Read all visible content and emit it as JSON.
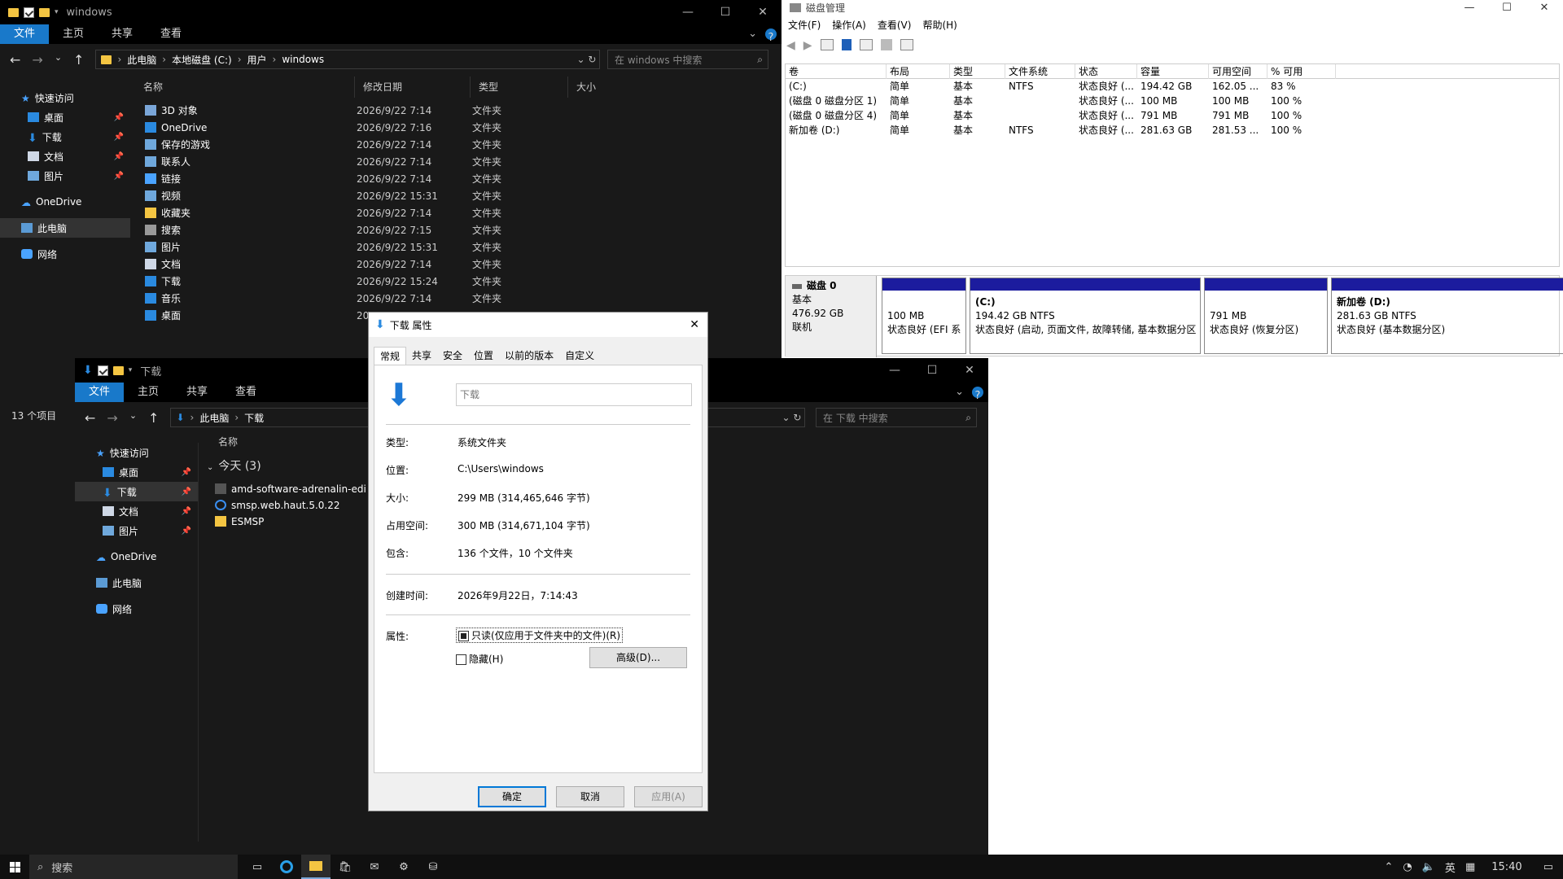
{
  "explorer_main": {
    "title": "windows",
    "ribbon_tabs": [
      "文件",
      "主页",
      "共享",
      "查看"
    ],
    "path": [
      "此电脑",
      "本地磁盘 (C:)",
      "用户",
      "windows"
    ],
    "search_placeholder": "在 windows 中搜索",
    "sidebar": [
      "快速访问",
      "桌面",
      "下载",
      "文档",
      "图片",
      "OneDrive",
      "此电脑",
      "网络"
    ],
    "columns": {
      "name": "名称",
      "date": "修改日期",
      "type": "类型",
      "size": "大小"
    },
    "rows": [
      {
        "name": "3D 对象",
        "date": "2026/9/22 7:14",
        "type": "文件夹",
        "icon": "3d-objects-icon"
      },
      {
        "name": "OneDrive",
        "date": "2026/9/22 7:16",
        "type": "文件夹",
        "icon": "onedrive-icon"
      },
      {
        "name": "保存的游戏",
        "date": "2026/9/22 7:14",
        "type": "文件夹",
        "icon": "saved-games-icon"
      },
      {
        "name": "联系人",
        "date": "2026/9/22 7:14",
        "type": "文件夹",
        "icon": "contacts-icon"
      },
      {
        "name": "链接",
        "date": "2026/9/22 7:14",
        "type": "文件夹",
        "icon": "links-icon"
      },
      {
        "name": "视频",
        "date": "2026/9/22 15:31",
        "type": "文件夹",
        "icon": "videos-icon"
      },
      {
        "name": "收藏夹",
        "date": "2026/9/22 7:14",
        "type": "文件夹",
        "icon": "favorites-icon"
      },
      {
        "name": "搜索",
        "date": "2026/9/22 7:15",
        "type": "文件夹",
        "icon": "searches-icon"
      },
      {
        "name": "图片",
        "date": "2026/9/22 15:31",
        "type": "文件夹",
        "icon": "pictures-icon"
      },
      {
        "name": "文档",
        "date": "2026/9/22 7:14",
        "type": "文件夹",
        "icon": "documents-icon"
      },
      {
        "name": "下载",
        "date": "2026/9/22 15:24",
        "type": "文件夹",
        "icon": "downloads-icon"
      },
      {
        "name": "音乐",
        "date": "2026/9/22 7:14",
        "type": "文件夹",
        "icon": "music-icon"
      },
      {
        "name": "桌面",
        "date": "20",
        "type": "",
        "icon": "desktop-icon"
      }
    ],
    "status": "13 个项目"
  },
  "explorer_downloads": {
    "title": "下载",
    "ribbon_tabs": [
      "文件",
      "主页",
      "共享",
      "查看"
    ],
    "path": [
      "此电脑",
      "下载"
    ],
    "search_placeholder": "在 下载 中搜索",
    "sidebar": [
      "快速访问",
      "桌面",
      "下载",
      "文档",
      "图片",
      "OneDrive",
      "此电脑",
      "网络"
    ],
    "col_name": "名称",
    "group": "今天 (3)",
    "files": [
      "amd-software-adrenalin-edi",
      "smsp.web.haut.5.0.22",
      "ESMSP"
    ]
  },
  "disk_mgmt": {
    "title": "磁盘管理",
    "menu": [
      "文件(F)",
      "操作(A)",
      "查看(V)",
      "帮助(H)"
    ],
    "columns": [
      "卷",
      "布局",
      "类型",
      "文件系统",
      "状态",
      "容量",
      "可用空间",
      "% 可用"
    ],
    "volumes": [
      [
        "(C:)",
        "简单",
        "基本",
        "NTFS",
        "状态良好 (...",
        "194.42 GB",
        "162.05 ...",
        "83 %"
      ],
      [
        "(磁盘 0 磁盘分区 1)",
        "简单",
        "基本",
        "",
        "状态良好 (...",
        "100 MB",
        "100 MB",
        "100 %"
      ],
      [
        "(磁盘 0 磁盘分区 4)",
        "简单",
        "基本",
        "",
        "状态良好 (...",
        "791 MB",
        "791 MB",
        "100 %"
      ],
      [
        "新加卷 (D:)",
        "简单",
        "基本",
        "NTFS",
        "状态良好 (...",
        "281.63 GB",
        "281.53 ...",
        "100 %"
      ]
    ],
    "disk": {
      "name": "磁盘 0",
      "kind": "基本",
      "size": "476.92 GB",
      "state": "联机"
    },
    "partitions": [
      {
        "title": "",
        "size": "100 MB",
        "status": "状态良好 (EFI 系"
      },
      {
        "title": "(C:)",
        "size": "194.42 GB NTFS",
        "status": "状态良好 (启动, 页面文件, 故障转储, 基本数据分区"
      },
      {
        "title": "",
        "size": "791 MB",
        "status": "状态良好 (恢复分区)"
      },
      {
        "title": "新加卷 (D:)",
        "size": "281.63 GB NTFS",
        "status": "状态良好 (基本数据分区)"
      }
    ]
  },
  "dialog": {
    "title": "下载 属性",
    "tabs": [
      "常规",
      "共享",
      "安全",
      "位置",
      "以前的版本",
      "自定义"
    ],
    "name_value": "下载",
    "fields": [
      {
        "k": "类型:",
        "v": "系统文件夹"
      },
      {
        "k": "位置:",
        "v": "C:\\Users\\windows"
      },
      {
        "k": "大小:",
        "v": "299 MB (314,465,646 字节)"
      },
      {
        "k": "占用空间:",
        "v": "300 MB (314,671,104 字节)"
      },
      {
        "k": "包含:",
        "v": "136 个文件，10 个文件夹"
      }
    ],
    "created_k": "创建时间:",
    "created_v": "2026年9月22日，7:14:43",
    "attr_k": "属性:",
    "readonly": "只读(仅应用于文件夹中的文件)(R)",
    "hidden": "隐藏(H)",
    "advanced": "高级(D)...",
    "ok": "确定",
    "cancel": "取消",
    "apply": "应用(A)"
  },
  "taskbar": {
    "search": "搜索",
    "ime": "英",
    "time": "15:40"
  }
}
